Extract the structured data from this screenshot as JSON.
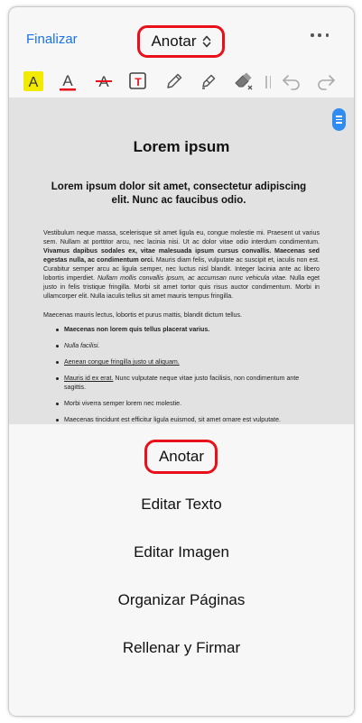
{
  "header": {
    "done_label": "Finalizar",
    "title": "Anotar"
  },
  "toolbar": {
    "icons": [
      "highlight-icon",
      "text-color-icon",
      "strikethrough-icon",
      "text-box-icon",
      "pencil-icon",
      "marker-icon",
      "eraser-icon",
      "undo-icon",
      "redo-icon"
    ],
    "highlight_color": "#f2ea00",
    "accent_red": "#e8101b"
  },
  "document": {
    "title": "Lorem ipsum",
    "subtitle": "Lorem ipsum dolor sit amet, consectetur adipiscing elit. Nunc ac faucibus odio.",
    "para1_a": "Vestibulum neque massa, scelerisque sit amet ligula eu, congue molestie mi. Praesent ut varius sem. Nullam at porttitor arcu, nec lacinia nisi. Ut ac dolor vitae odio interdum condimentum. ",
    "para1_b": "Vivamus dapibus sodales ex, vitae malesuada ipsum cursus convallis. Maecenas sed egestas nulla, ac condimentum orci.",
    "para1_c": " Mauris diam felis, vulputate ac suscipit et, iaculis non est. Curabitur semper arcu ac ligula semper, nec luctus nisl blandit. Integer lacinia ante ac libero lobortis imperdiet. ",
    "para1_d": "Nullam mollis convallis ipsum, ac accumsan nunc vehicula vitae.",
    "para1_e": " Nulla eget justo in felis tristique fringilla. Morbi sit amet tortor quis risus auctor condimentum. Morbi in ullamcorper elit. Nulla iaculis tellus sit amet mauris tempus fringilla.",
    "para2": "Maecenas mauris lectus, lobortis et purus mattis, blandit dictum tellus.",
    "list": [
      "Maecenas non lorem quis tellus placerat varius.",
      "Nulla facilisi.",
      "Aenean congue fringilla justo ut aliquam.",
      "Mauris id ex erat.",
      " Nunc vulputate neque vitae justo facilisis, non condimentum ante sagittis.",
      "Morbi viverra semper lorem nec molestie.",
      "Maecenas tincidunt est efficitur ligula euismod, sit amet ornare est vulputate."
    ]
  },
  "menu": {
    "items": [
      "Anotar",
      "Editar Texto",
      "Editar Imagen",
      "Organizar Páginas",
      "Rellenar y Firmar"
    ]
  }
}
